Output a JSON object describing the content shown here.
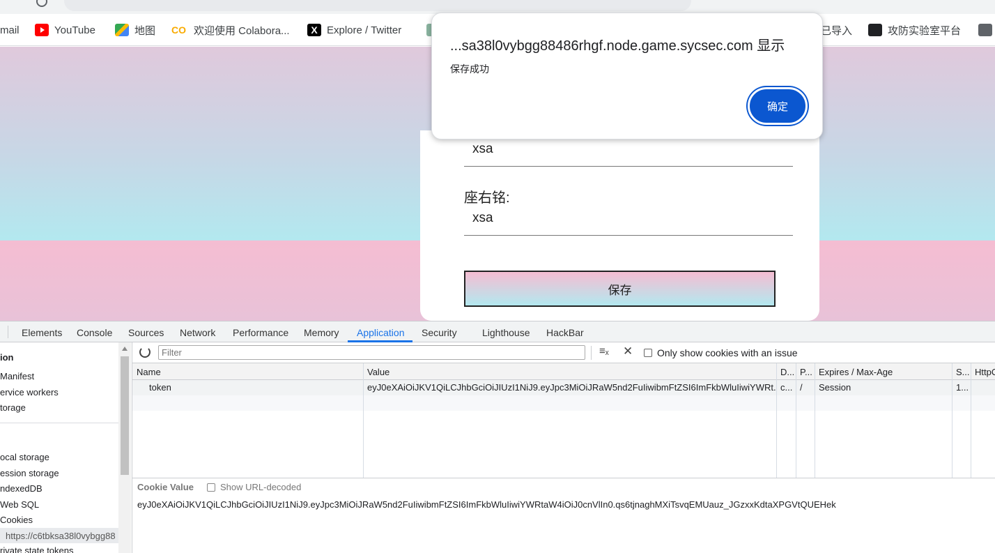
{
  "bookmarks": {
    "gmail": "mail",
    "youtube": "YouTube",
    "maps": "地图",
    "colab": "欢迎使用 Colabora...",
    "twitter": "Explore / Twitter",
    "imported": "已导入",
    "lab": "攻防实验室平台"
  },
  "form": {
    "name_value": "xsa",
    "motto_label": "座右铭:",
    "motto_value": "xsa",
    "save_label": "保存"
  },
  "dialog": {
    "title": "...sa38l0vybgg88486rhgf.node.game.sycsec.com 显示",
    "message": "保存成功",
    "ok_label": "确定"
  },
  "devtools": {
    "tabs": [
      "Elements",
      "Console",
      "Sources",
      "Network",
      "Performance",
      "Memory",
      "Application",
      "Security",
      "Lighthouse",
      "HackBar"
    ],
    "sidebar": {
      "section": "ion",
      "manifest": "Manifest",
      "service_workers": "ervice workers",
      "storage": "torage",
      "local_storage": "ocal storage",
      "session_storage": "ession storage",
      "indexeddb": "ndexedDB",
      "web_sql": "Web SQL",
      "cookies": "Cookies",
      "cookie_origin": "https://c6tbksa38l0vybgg88",
      "private_state": "rivate state tokens"
    },
    "toolbar": {
      "filter_placeholder": "Filter",
      "only_issues_label": "Only show cookies with an issue"
    },
    "table": {
      "headers": {
        "name": "Name",
        "value": "Value",
        "domain": "D...",
        "path": "P...",
        "expires": "Expires / Max-Age",
        "size": "S...",
        "httponly": "HttpO"
      },
      "row": {
        "name": "token",
        "value": "eyJ0eXAiOiJKV1QiLCJhbGciOiJIUzI1NiJ9.eyJpc3MiOiJRaW5nd2FuIiwibmFtZSI6ImFkbWluIiwiYWRt...",
        "domain": "c...",
        "path": "/",
        "expires": "Session",
        "size": "1..."
      }
    },
    "cookie_value": {
      "label": "Cookie Value",
      "url_decoded_label": "Show URL-decoded",
      "value": "eyJ0eXAiOiJKV1QiLCJhbGciOiJIUzI1NiJ9.eyJpc3MiOiJRaW5nd2FuIiwibmFtZSI6ImFkbWluIiwiYWRtaW4iOiJ0cnVlIn0.qs6tjnaghMXiTsvqEMUauz_JGzxxKdtaXPGVtQUEHek"
    }
  },
  "colors": {
    "accent": "#1a73e8",
    "dialog_button": "#0b57d0"
  }
}
